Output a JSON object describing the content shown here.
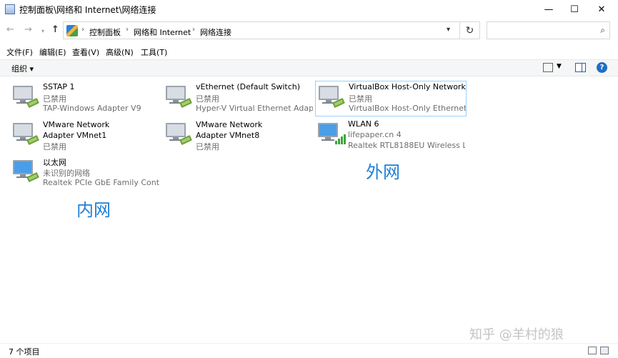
{
  "window": {
    "title": "控制面板\\网络和 Internet\\网络连接",
    "minimize_icon": "minimize-icon",
    "maximize_icon": "maximize-icon",
    "close_icon": "close-icon"
  },
  "address": {
    "crumbs": [
      "控制面板",
      "网络和 Internet",
      "网络连接"
    ],
    "search_placeholder": ""
  },
  "menu": [
    "文件(F)",
    "编辑(E)",
    "查看(V)",
    "高级(N)",
    "工具(T)"
  ],
  "commands": {
    "organize": "组织 ▾"
  },
  "connections": [
    {
      "name": "SSTAP 1",
      "status": "已禁用",
      "device": "TAP-Windows Adapter V9",
      "icon": "network-adapter-disabled-icon"
    },
    {
      "name": "vEthernet (Default Switch)",
      "status": "已禁用",
      "device": "Hyper-V Virtual Ethernet Adap...",
      "icon": "network-adapter-disabled-icon"
    },
    {
      "name": "VirtualBox Host-Only Network",
      "status": "已禁用",
      "device": "VirtualBox Host-Only Ethernet ...",
      "icon": "network-adapter-disabled-icon",
      "selected": true
    },
    {
      "name": "VMware Network Adapter VMnet1",
      "status": "已禁用",
      "device": "",
      "icon": "network-adapter-disabled-icon"
    },
    {
      "name": "VMware Network Adapter VMnet8",
      "status": "已禁用",
      "device": "",
      "icon": "network-adapter-disabled-icon"
    },
    {
      "name": "WLAN 6",
      "status": "lifepaper.cn 4",
      "device": "Realtek RTL8188EU Wireless L...",
      "icon": "wifi-adapter-connected-icon"
    },
    {
      "name": "以太网",
      "status": "未识别的网络",
      "device": "Realtek PCIe GbE Family Contr...",
      "icon": "ethernet-adapter-connected-icon"
    }
  ],
  "annotations": {
    "outer": "外网",
    "inner": "内网"
  },
  "statusbar": {
    "count": "7 个项目"
  },
  "watermark": "知乎 @羊村的狼",
  "colors": {
    "accent": "#1e7fd6",
    "selection_border": "#99d1ff"
  }
}
